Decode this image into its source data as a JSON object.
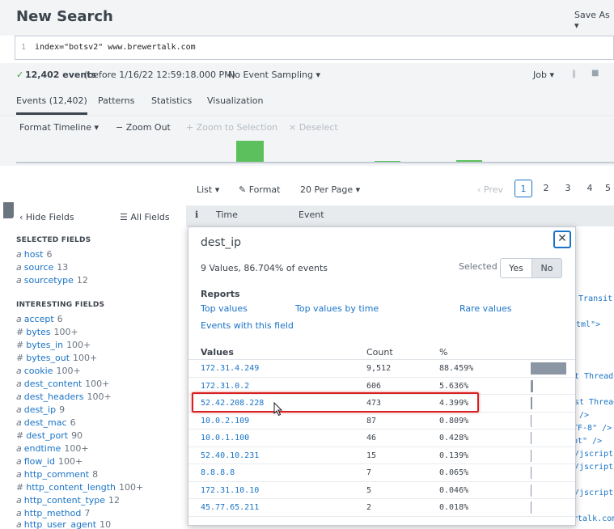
{
  "header": {
    "title": "New Search",
    "save_as": "Save As ▾"
  },
  "search": {
    "line_number": "1",
    "query": "index=\"botsv2\" www.brewertalk.com"
  },
  "status": {
    "check": "✓",
    "count": "12,402 events",
    "before": "(before 1/16/22 12:59:18.000 PM)",
    "sampling": "No Event Sampling ▾",
    "job": "Job ▾",
    "pause": "‖",
    "stop": "■"
  },
  "tabs": [
    "Events (12,402)",
    "Patterns",
    "Statistics",
    "Visualization"
  ],
  "timeline_toolbar": {
    "format": "Format Timeline ▾",
    "zoom_out": "− Zoom Out",
    "zoom_sel": "+ Zoom to Selection",
    "deselect": "× Deselect"
  },
  "timeline": {
    "bar_color": "#5cc05c"
  },
  "pager": {
    "list": "List ▾",
    "format": "✎ Format",
    "per_page": "20 Per Page ▾",
    "prev": "‹ Prev",
    "pages": [
      "1",
      "2",
      "3",
      "4",
      "5"
    ]
  },
  "sidebar": {
    "hide_fields": "‹ Hide Fields",
    "all_fields": "☰ All Fields",
    "selected_title": "SELECTED FIELDS",
    "selected": [
      {
        "type": "a",
        "name": "host",
        "count": "6"
      },
      {
        "type": "a",
        "name": "source",
        "count": "13"
      },
      {
        "type": "a",
        "name": "sourcetype",
        "count": "12"
      }
    ],
    "interesting_title": "INTERESTING FIELDS",
    "interesting": [
      {
        "type": "a",
        "name": "accept",
        "count": "6"
      },
      {
        "type": "#",
        "name": "bytes",
        "count": "100+"
      },
      {
        "type": "#",
        "name": "bytes_in",
        "count": "100+"
      },
      {
        "type": "#",
        "name": "bytes_out",
        "count": "100+"
      },
      {
        "type": "a",
        "name": "cookie",
        "count": "100+"
      },
      {
        "type": "a",
        "name": "dest_content",
        "count": "100+"
      },
      {
        "type": "a",
        "name": "dest_headers",
        "count": "100+"
      },
      {
        "type": "a",
        "name": "dest_ip",
        "count": "9"
      },
      {
        "type": "a",
        "name": "dest_mac",
        "count": "6"
      },
      {
        "type": "#",
        "name": "dest_port",
        "count": "90"
      },
      {
        "type": "a",
        "name": "endtime",
        "count": "100+"
      },
      {
        "type": "a",
        "name": "flow_id",
        "count": "100+"
      },
      {
        "type": "a",
        "name": "http_comment",
        "count": "8"
      },
      {
        "type": "#",
        "name": "http_content_length",
        "count": "100+"
      },
      {
        "type": "a",
        "name": "http_content_type",
        "count": "12"
      },
      {
        "type": "a",
        "name": "http_method",
        "count": "7"
      },
      {
        "type": "a",
        "name": "http_user_agent",
        "count": "10"
      }
    ]
  },
  "events_header": {
    "info": "i",
    "time": "Time",
    "event": "Event"
  },
  "event_fragments": [
    "> Transit",
    "html\">",
    "t Threads",
    "st Threads",
    "/>",
    "TF-8\" />",
    "pt\" />",
    "/jscripts",
    "/jscripts",
    "/jscripts",
    "rtalk.com"
  ],
  "popup": {
    "title": "dest_ip",
    "close": "✕",
    "summary": "9 Values, 86.704% of events",
    "selected_label": "Selected",
    "yes": "Yes",
    "no": "No",
    "reports_title": "Reports",
    "reports": {
      "top_values": "Top values",
      "top_values_by_time": "Top values by time",
      "rare_values": "Rare values",
      "events_with_field": "Events with this field"
    },
    "columns": {
      "values": "Values",
      "count": "Count",
      "pct": "%"
    },
    "bar_color": "#8a96a3",
    "rows": [
      {
        "value": "172.31.4.249",
        "count": "9,512",
        "pct": "88.459%",
        "frac": 0.88459
      },
      {
        "value": "172.31.0.2",
        "count": "606",
        "pct": "5.636%",
        "frac": 0.05636
      },
      {
        "value": "52.42.208.228",
        "count": "473",
        "pct": "4.399%",
        "frac": 0.04399
      },
      {
        "value": "10.0.2.109",
        "count": "87",
        "pct": "0.809%",
        "frac": 0.00809
      },
      {
        "value": "10.0.1.100",
        "count": "46",
        "pct": "0.428%",
        "frac": 0.00428
      },
      {
        "value": "52.40.10.231",
        "count": "15",
        "pct": "0.139%",
        "frac": 0.00139
      },
      {
        "value": "8.8.8.8",
        "count": "7",
        "pct": "0.065%",
        "frac": 0.00065
      },
      {
        "value": "172.31.10.10",
        "count": "5",
        "pct": "0.046%",
        "frac": 0.00046
      },
      {
        "value": "45.77.65.211",
        "count": "2",
        "pct": "0.018%",
        "frac": 0.00018
      }
    ]
  }
}
